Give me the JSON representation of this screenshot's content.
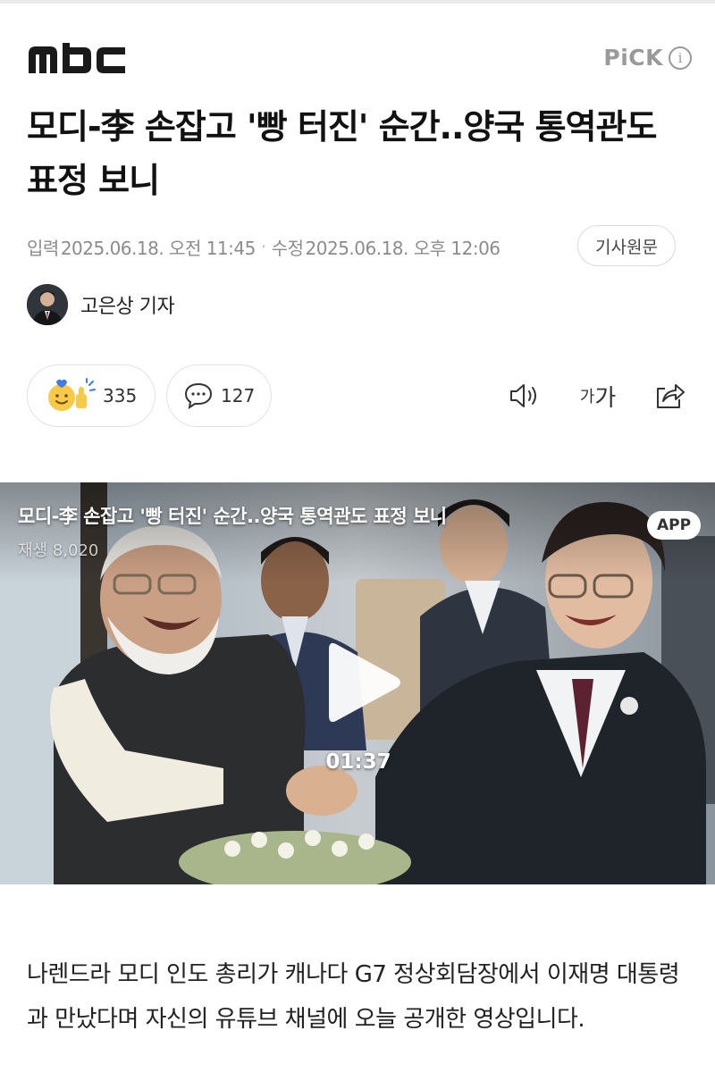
{
  "header": {
    "logo_text": "MBC",
    "pick_label": "PiCK",
    "pick_info_icon": "info-icon"
  },
  "article": {
    "title": "모디-李 손잡고 '빵 터진' 순간..양국 통역관도 표정 보니",
    "published_label": "입력",
    "published_time": "2025.06.18. 오전 11:45",
    "modified_label": "수정",
    "modified_time": "2025.06.18. 오후 12:06",
    "original_button": "기사원문",
    "reporter": "고은상 기자",
    "body": "나렌드라 모디 인도 총리가 캐나다 G7 정상회담장에서 이재명 대통령과 만났다며 자신의 유튜브 채널에 오늘 공개한 영상입니다."
  },
  "actions": {
    "reaction_icon": "reaction-emoji-icon",
    "reaction_count": "335",
    "comment_icon": "comment-bubble-icon",
    "comment_count": "127",
    "audio_icon": "speaker-icon",
    "font_size_small": "가",
    "font_size_large": "가",
    "share_icon": "share-icon"
  },
  "video": {
    "title": "모디-李 손잡고 '빵 터진' 순간..양국 통역관도 표정 보니",
    "views": "재생 8,020",
    "badge": "APP",
    "duration": "01:37",
    "play_icon": "play-icon"
  },
  "colors": {
    "logo": "#1a1a1a",
    "meta_text": "#8c8c8c",
    "pick_gray": "#9a9a9a",
    "border": "#e2e2e2"
  }
}
